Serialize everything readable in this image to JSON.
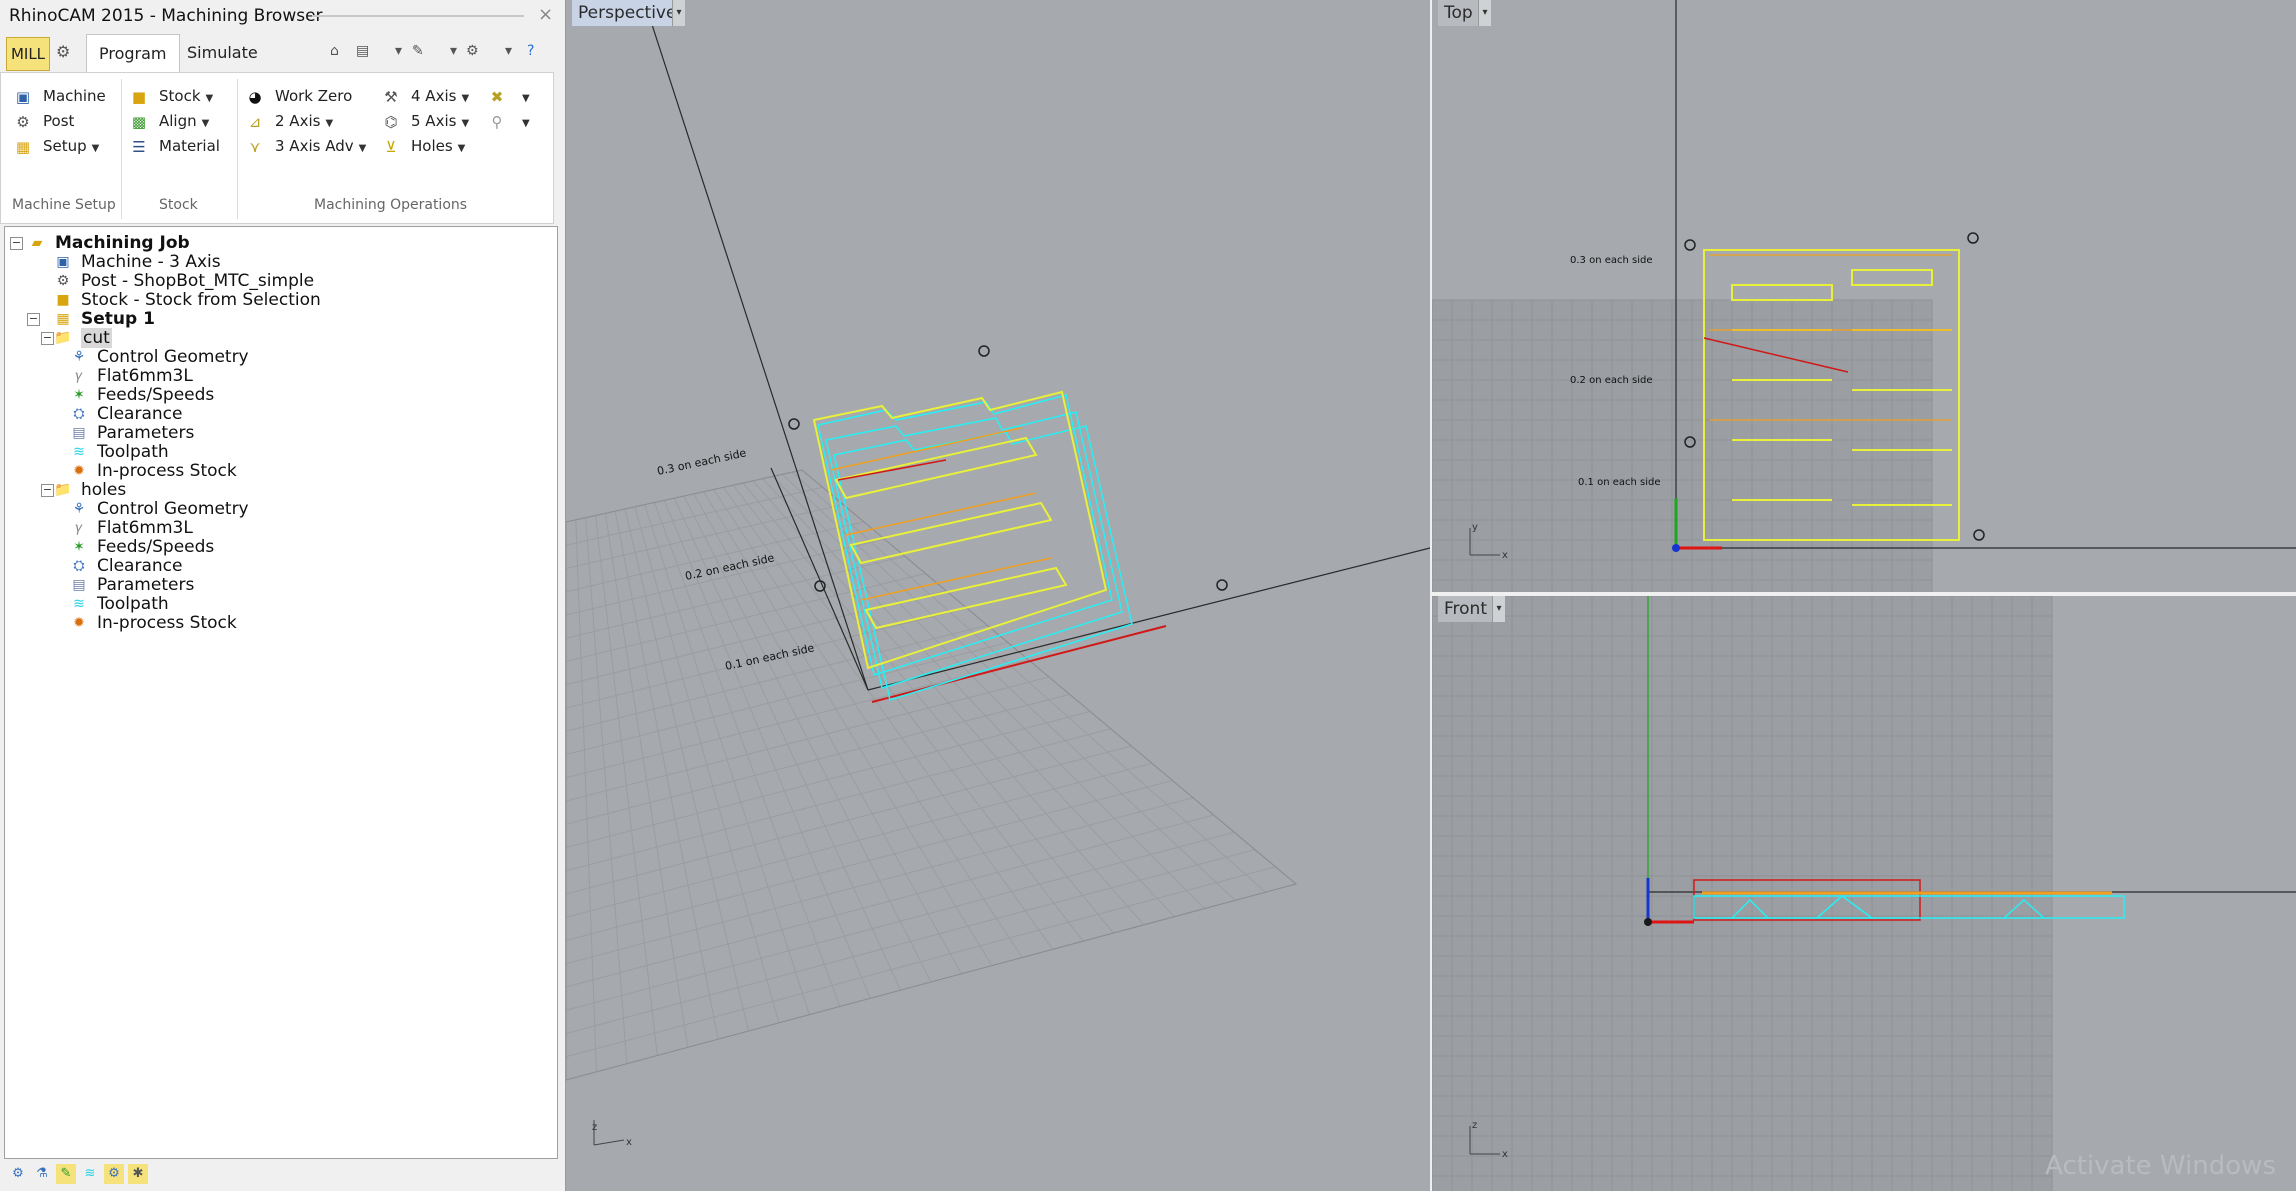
{
  "window": {
    "title": "RhinoCAM 2015 - Machining Browser",
    "close": "×"
  },
  "tabs": {
    "mill": "MILL",
    "program": "Program",
    "simulate": "Simulate"
  },
  "ribbon": {
    "machine_setup": {
      "label": "Machine Setup",
      "machine": "Machine",
      "post": "Post",
      "setup": "Setup"
    },
    "stock": {
      "label": "Stock",
      "stock": "Stock",
      "align": "Align",
      "material": "Material"
    },
    "machining_operations": {
      "label": "Machining Operations",
      "work_zero": "Work Zero",
      "two_axis": "2 Axis",
      "three_axis_adv": "3 Axis Adv",
      "four_axis": "4 Axis",
      "five_axis": "5 Axis",
      "holes": "Holes"
    }
  },
  "tree": {
    "job": "Machining Job",
    "machine": "Machine - 3 Axis",
    "post": "Post - ShopBot_MTC_simple",
    "stock": "Stock - Stock from Selection",
    "setup": "Setup 1",
    "cut": {
      "name": "cut",
      "items": [
        "Control Geometry",
        "Flat6mm3L",
        "Feeds/Speeds",
        "Clearance",
        "Parameters",
        "Toolpath",
        "In-process Stock"
      ]
    },
    "holes": {
      "name": "holes",
      "items": [
        "Control Geometry",
        "Flat6mm3L",
        "Feeds/Speeds",
        "Clearance",
        "Parameters",
        "Toolpath",
        "In-process Stock"
      ]
    }
  },
  "viewports": {
    "perspective": "Perspective",
    "top": "Top",
    "front": "Front",
    "annotations": [
      "0.3 on each side",
      "0.2 on each side",
      "0.1 on each side"
    ],
    "axis_y": "y",
    "axis_x": "x",
    "axis_z": "z"
  },
  "watermark": "Activate Windows",
  "colors": {
    "viewport_bg": "#a6a9ad",
    "part": "#e8f03a",
    "toolpath": "#26f0f5",
    "stock": "#e01414",
    "outline": "#f0a020"
  }
}
